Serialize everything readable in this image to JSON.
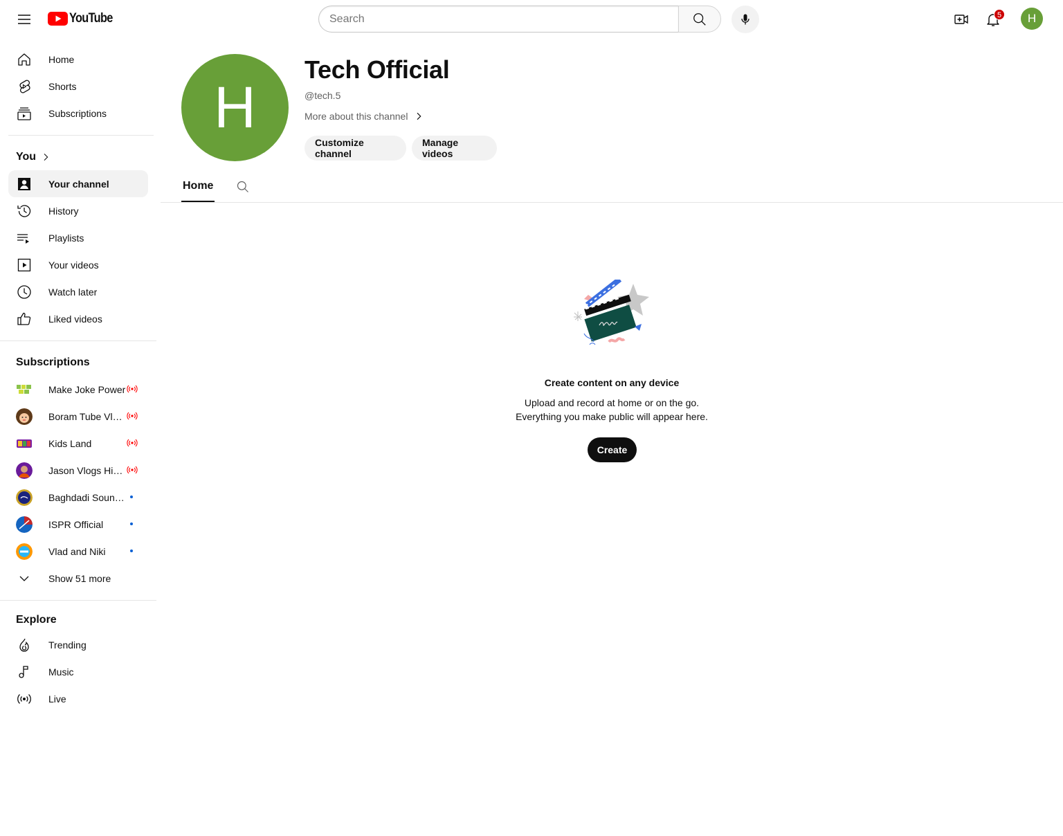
{
  "header": {
    "logo_text": "YouTube",
    "search_placeholder": "Search",
    "notification_count": "5",
    "avatar_letter": "H",
    "brand_color": "#ff0000",
    "avatar_color": "#689f38"
  },
  "sidebar": {
    "main": [
      {
        "label": "Home",
        "icon": "home-icon"
      },
      {
        "label": "Shorts",
        "icon": "shorts-icon"
      },
      {
        "label": "Subscriptions",
        "icon": "subscriptions-icon"
      }
    ],
    "you_heading": "You",
    "you": [
      {
        "label": "Your channel",
        "icon": "your-channel-icon",
        "active": true
      },
      {
        "label": "History",
        "icon": "history-icon"
      },
      {
        "label": "Playlists",
        "icon": "playlists-icon"
      },
      {
        "label": "Your videos",
        "icon": "your-videos-icon"
      },
      {
        "label": "Watch later",
        "icon": "watch-later-icon"
      },
      {
        "label": "Liked videos",
        "icon": "liked-videos-icon"
      }
    ],
    "subscriptions_heading": "Subscriptions",
    "subscriptions": [
      {
        "label": "Make Joke Power",
        "status": "live"
      },
      {
        "label": "Boram Tube Vlo…",
        "status": "live"
      },
      {
        "label": "Kids Land",
        "status": "live"
      },
      {
        "label": "Jason Vlogs Hindi",
        "status": "live"
      },
      {
        "label": "Baghdadi Sound …",
        "status": "new"
      },
      {
        "label": "ISPR Official",
        "status": "new"
      },
      {
        "label": "Vlad and Niki",
        "status": "new"
      }
    ],
    "show_more": "Show 51 more",
    "explore_heading": "Explore",
    "explore": [
      {
        "label": "Trending",
        "icon": "trending-icon"
      },
      {
        "label": "Music",
        "icon": "music-icon"
      },
      {
        "label": "Live",
        "icon": "live-icon"
      }
    ]
  },
  "channel": {
    "avatar_letter": "H",
    "name": "Tech Official",
    "handle": "@tech.5",
    "more_about": "More about this channel",
    "customize_label": "Customize channel",
    "manage_label": "Manage videos"
  },
  "tabs": {
    "home": "Home"
  },
  "empty_state": {
    "title": "Create content on any device",
    "line1": "Upload and record at home or on the go.",
    "line2": "Everything you make public will appear here.",
    "create_label": "Create"
  },
  "colors": {
    "live_red": "#ff0000",
    "new_dot_blue": "#065fd4"
  }
}
